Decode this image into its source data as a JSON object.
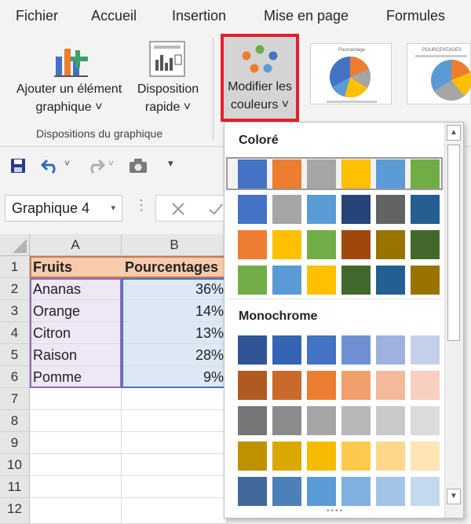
{
  "menu": {
    "tabs": [
      "Fichier",
      "Accueil",
      "Insertion",
      "Mise en page",
      "Formules"
    ]
  },
  "ribbon": {
    "add_chart_element": {
      "line1": "Ajouter un élément",
      "line2": "graphique ˅"
    },
    "quick_layout": {
      "line1": "Disposition",
      "line2": "rapide ˅"
    },
    "change_colors": {
      "line1": "Modifier les",
      "line2": "couleurs ˅"
    },
    "group_label": "Dispositions du graphique",
    "style_thumb1_title": "Pourcentage",
    "style_thumb2_title": "POURCENTAGES",
    "highlight_color": "#e32028"
  },
  "namebox": {
    "value": "Graphique 4"
  },
  "sheet": {
    "columns": [
      "A",
      "B"
    ],
    "rows": [
      "1",
      "2",
      "3",
      "4",
      "5",
      "6",
      "7",
      "8",
      "9",
      "10",
      "11",
      "12"
    ],
    "header": [
      "Fruits",
      "Pourcentages"
    ],
    "data": [
      [
        "Ananas",
        "36%"
      ],
      [
        "Orange",
        "14%"
      ],
      [
        "Citron",
        "13%"
      ],
      [
        "Raison",
        "28%"
      ],
      [
        "Pomme",
        "9%"
      ]
    ],
    "colors": {
      "header_a": "#f8cbad",
      "header_b": "#f8cbad",
      "data_a": "#ede7f6",
      "data_b": "#dde8f7"
    }
  },
  "dropdown": {
    "colorful_title": "Coloré",
    "mono_title": "Monochrome",
    "colorful_rows": [
      [
        "#4472c4",
        "#ed7d31",
        "#a5a5a5",
        "#ffc000",
        "#5b9bd5",
        "#70ad47"
      ],
      [
        "#4472c4",
        "#a5a5a5",
        "#5b9bd5",
        "#264478",
        "#636363",
        "#255e91"
      ],
      [
        "#ed7d31",
        "#ffc000",
        "#70ad47",
        "#9e480e",
        "#997300",
        "#43682b"
      ],
      [
        "#70ad47",
        "#5b9bd5",
        "#ffc000",
        "#43682b",
        "#255e91",
        "#997300"
      ]
    ],
    "mono_rows": [
      [
        "#2f5597",
        "#3763b5",
        "#4472c4",
        "#6f8fd4",
        "#9eb2df",
        "#c4d0eb"
      ],
      [
        "#ae5a21",
        "#c9692a",
        "#ed7d31",
        "#f19f6c",
        "#f4b89a",
        "#f8cfc0"
      ],
      [
        "#767676",
        "#8c8c8c",
        "#a5a5a5",
        "#b7b7b7",
        "#c9c9c9",
        "#dbdbdb"
      ],
      [
        "#bf9000",
        "#dba800",
        "#f4bb00",
        "#ffc94d",
        "#ffd78a",
        "#ffe4b5"
      ],
      [
        "#42699b",
        "#4d7fb8",
        "#5b9bd5",
        "#7fb0e0",
        "#a2c4e7",
        "#c4d9ef"
      ]
    ]
  }
}
